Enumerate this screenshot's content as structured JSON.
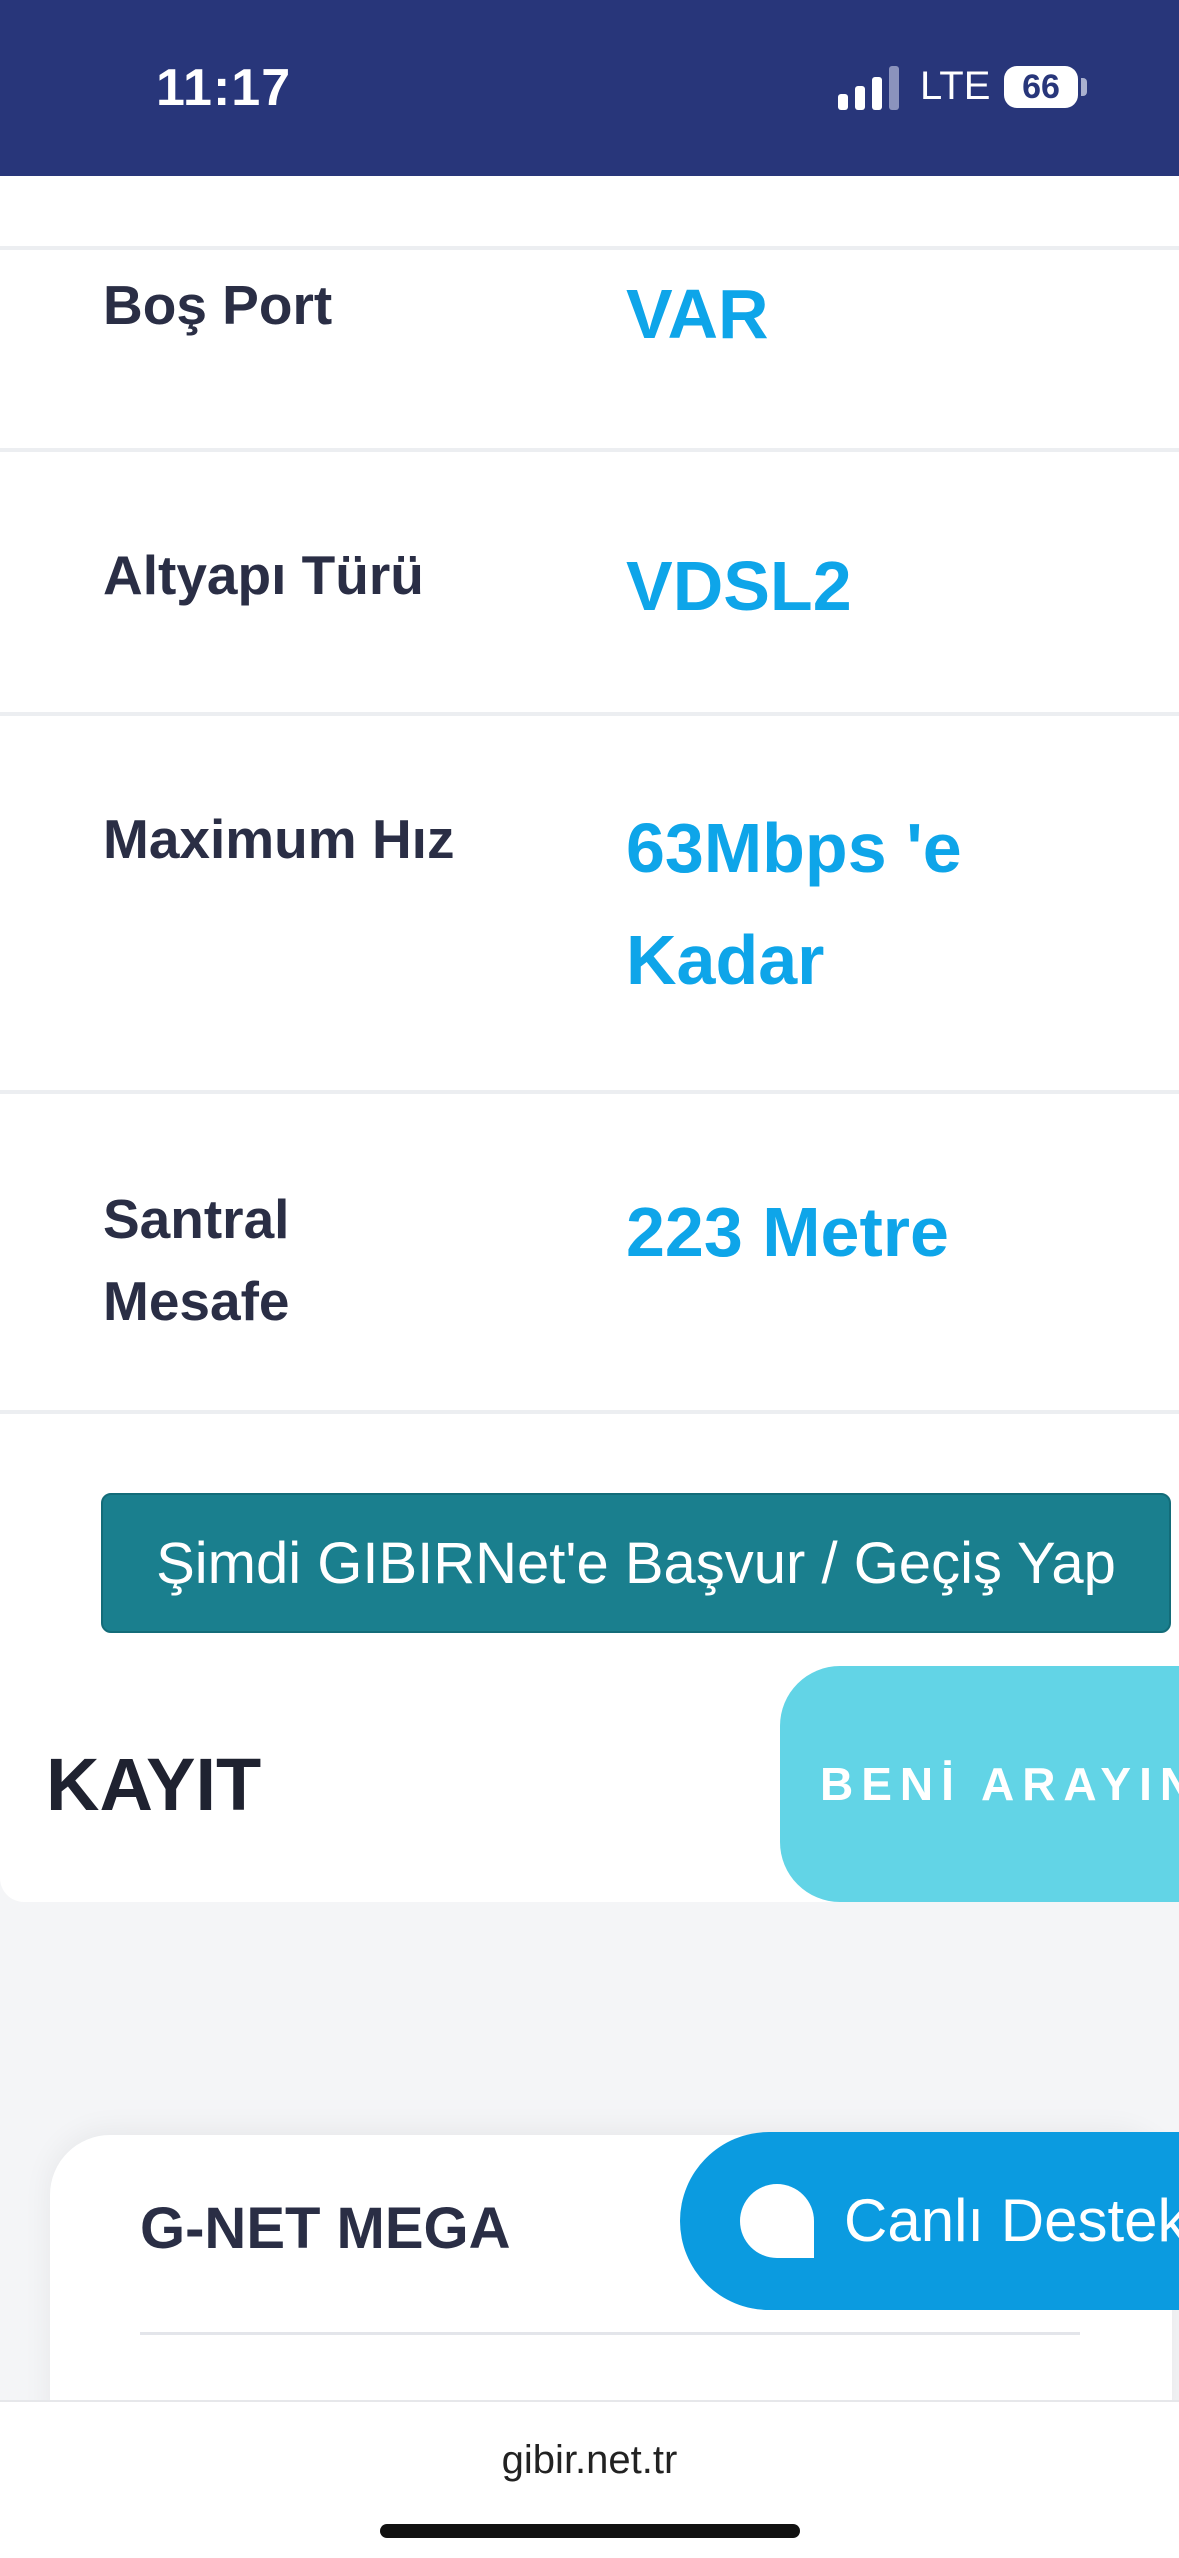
{
  "status_bar": {
    "time": "11:17",
    "network": "LTE",
    "battery": "66"
  },
  "details": [
    {
      "label": "Boş Port",
      "value": "VAR"
    },
    {
      "label": "Altyapı Türü",
      "value": "VDSL2"
    },
    {
      "label": "Maximum Hız",
      "value": "63Mbps 'e Kadar"
    },
    {
      "label": "Santral Mesafe",
      "value": "223 Metre"
    }
  ],
  "apply_button": "Şimdi GIBIRNet'e Başvur / Geçiş Yap",
  "kayit": {
    "title": "KAYIT",
    "call_button": "BENİ ARAYIN"
  },
  "plan": {
    "title": "G-NET MEGA"
  },
  "chat": {
    "label": "Canlı Destek"
  },
  "browser": {
    "url": "gibir.net.tr"
  },
  "colors": {
    "header": "#28367a",
    "accent": "#0ea5e9",
    "button": "#1a7f8e",
    "call": "#62d4e6"
  }
}
